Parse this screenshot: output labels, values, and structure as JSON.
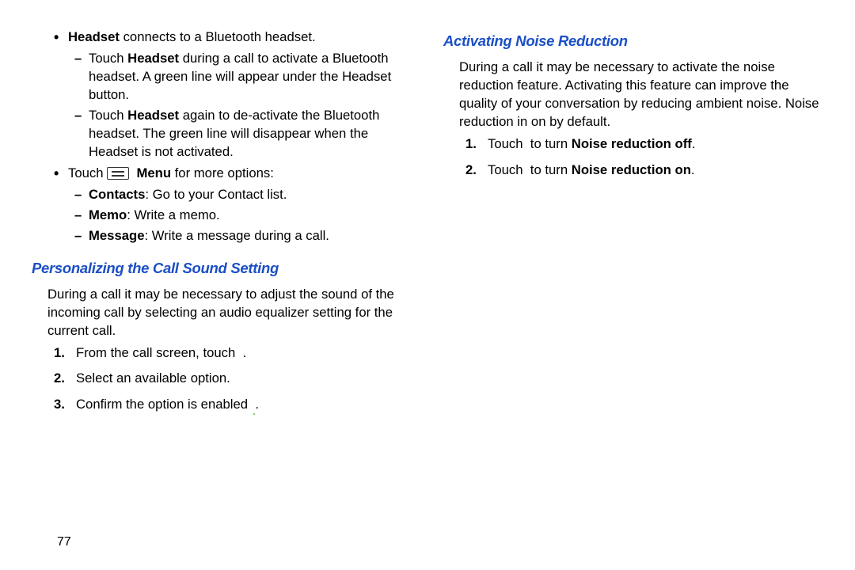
{
  "page_number": "77",
  "left": {
    "headset": {
      "label": "Headset",
      "desc": " connects to a Bluetooth headset.",
      "sub": [
        {
          "pre": "Touch ",
          "bold": "Headset",
          "post": " during a call to activate a Bluetooth headset. A green line will appear under the Headset button."
        },
        {
          "pre": "Touch ",
          "bold": "Headset",
          "post": " again to de-activate the Bluetooth headset. The green line will disappear when the Headset is not activated."
        }
      ]
    },
    "menu": {
      "pre": "Touch ",
      "icon_name": "menu-icon",
      "bold_after_icon": "Menu",
      "post": " for more options:",
      "items": [
        {
          "bold": "Contacts",
          "post": ": Go to your Contact list."
        },
        {
          "bold": "Memo",
          "post": ": Write a memo."
        },
        {
          "bold": "Message",
          "post": ": Write a message during a call."
        }
      ]
    },
    "section_title": "Personalizing the Call Sound Setting",
    "section_para": "During a call it may be necessary to adjust the sound of the incoming call by selecting an audio equalizer setting for the current call.",
    "steps": [
      {
        "pre": "From the call screen, touch ",
        "icon": "equalizer-circle-icon",
        "iconClass": "ic-circ",
        "post": " ."
      },
      {
        "pre": "Select an available option."
      },
      {
        "pre": "Confirm the option is enabled ",
        "icon": "equalizer-enabled-icon",
        "iconClass": "ic-circ green",
        "post": " ."
      }
    ]
  },
  "right": {
    "section_title": "Activating Noise Reduction",
    "section_para": "During a call it may be necessary to activate the noise reduction feature. Activating this feature can improve the quality of your conversation by reducing ambient noise. Noise reduction in on by default.",
    "steps": [
      {
        "pre": "Touch ",
        "icon": "noise-reduction-off-icon",
        "iconClass": "ic-square ic-noise-off",
        "post_pre": " to turn ",
        "bold": "Noise reduction off",
        "post": "."
      },
      {
        "pre": "Touch ",
        "icon": "noise-reduction-on-icon",
        "iconClass": "ic-square ic-noise-on",
        "post_pre": " to turn ",
        "bold": "Noise reduction on",
        "post": "."
      }
    ]
  }
}
